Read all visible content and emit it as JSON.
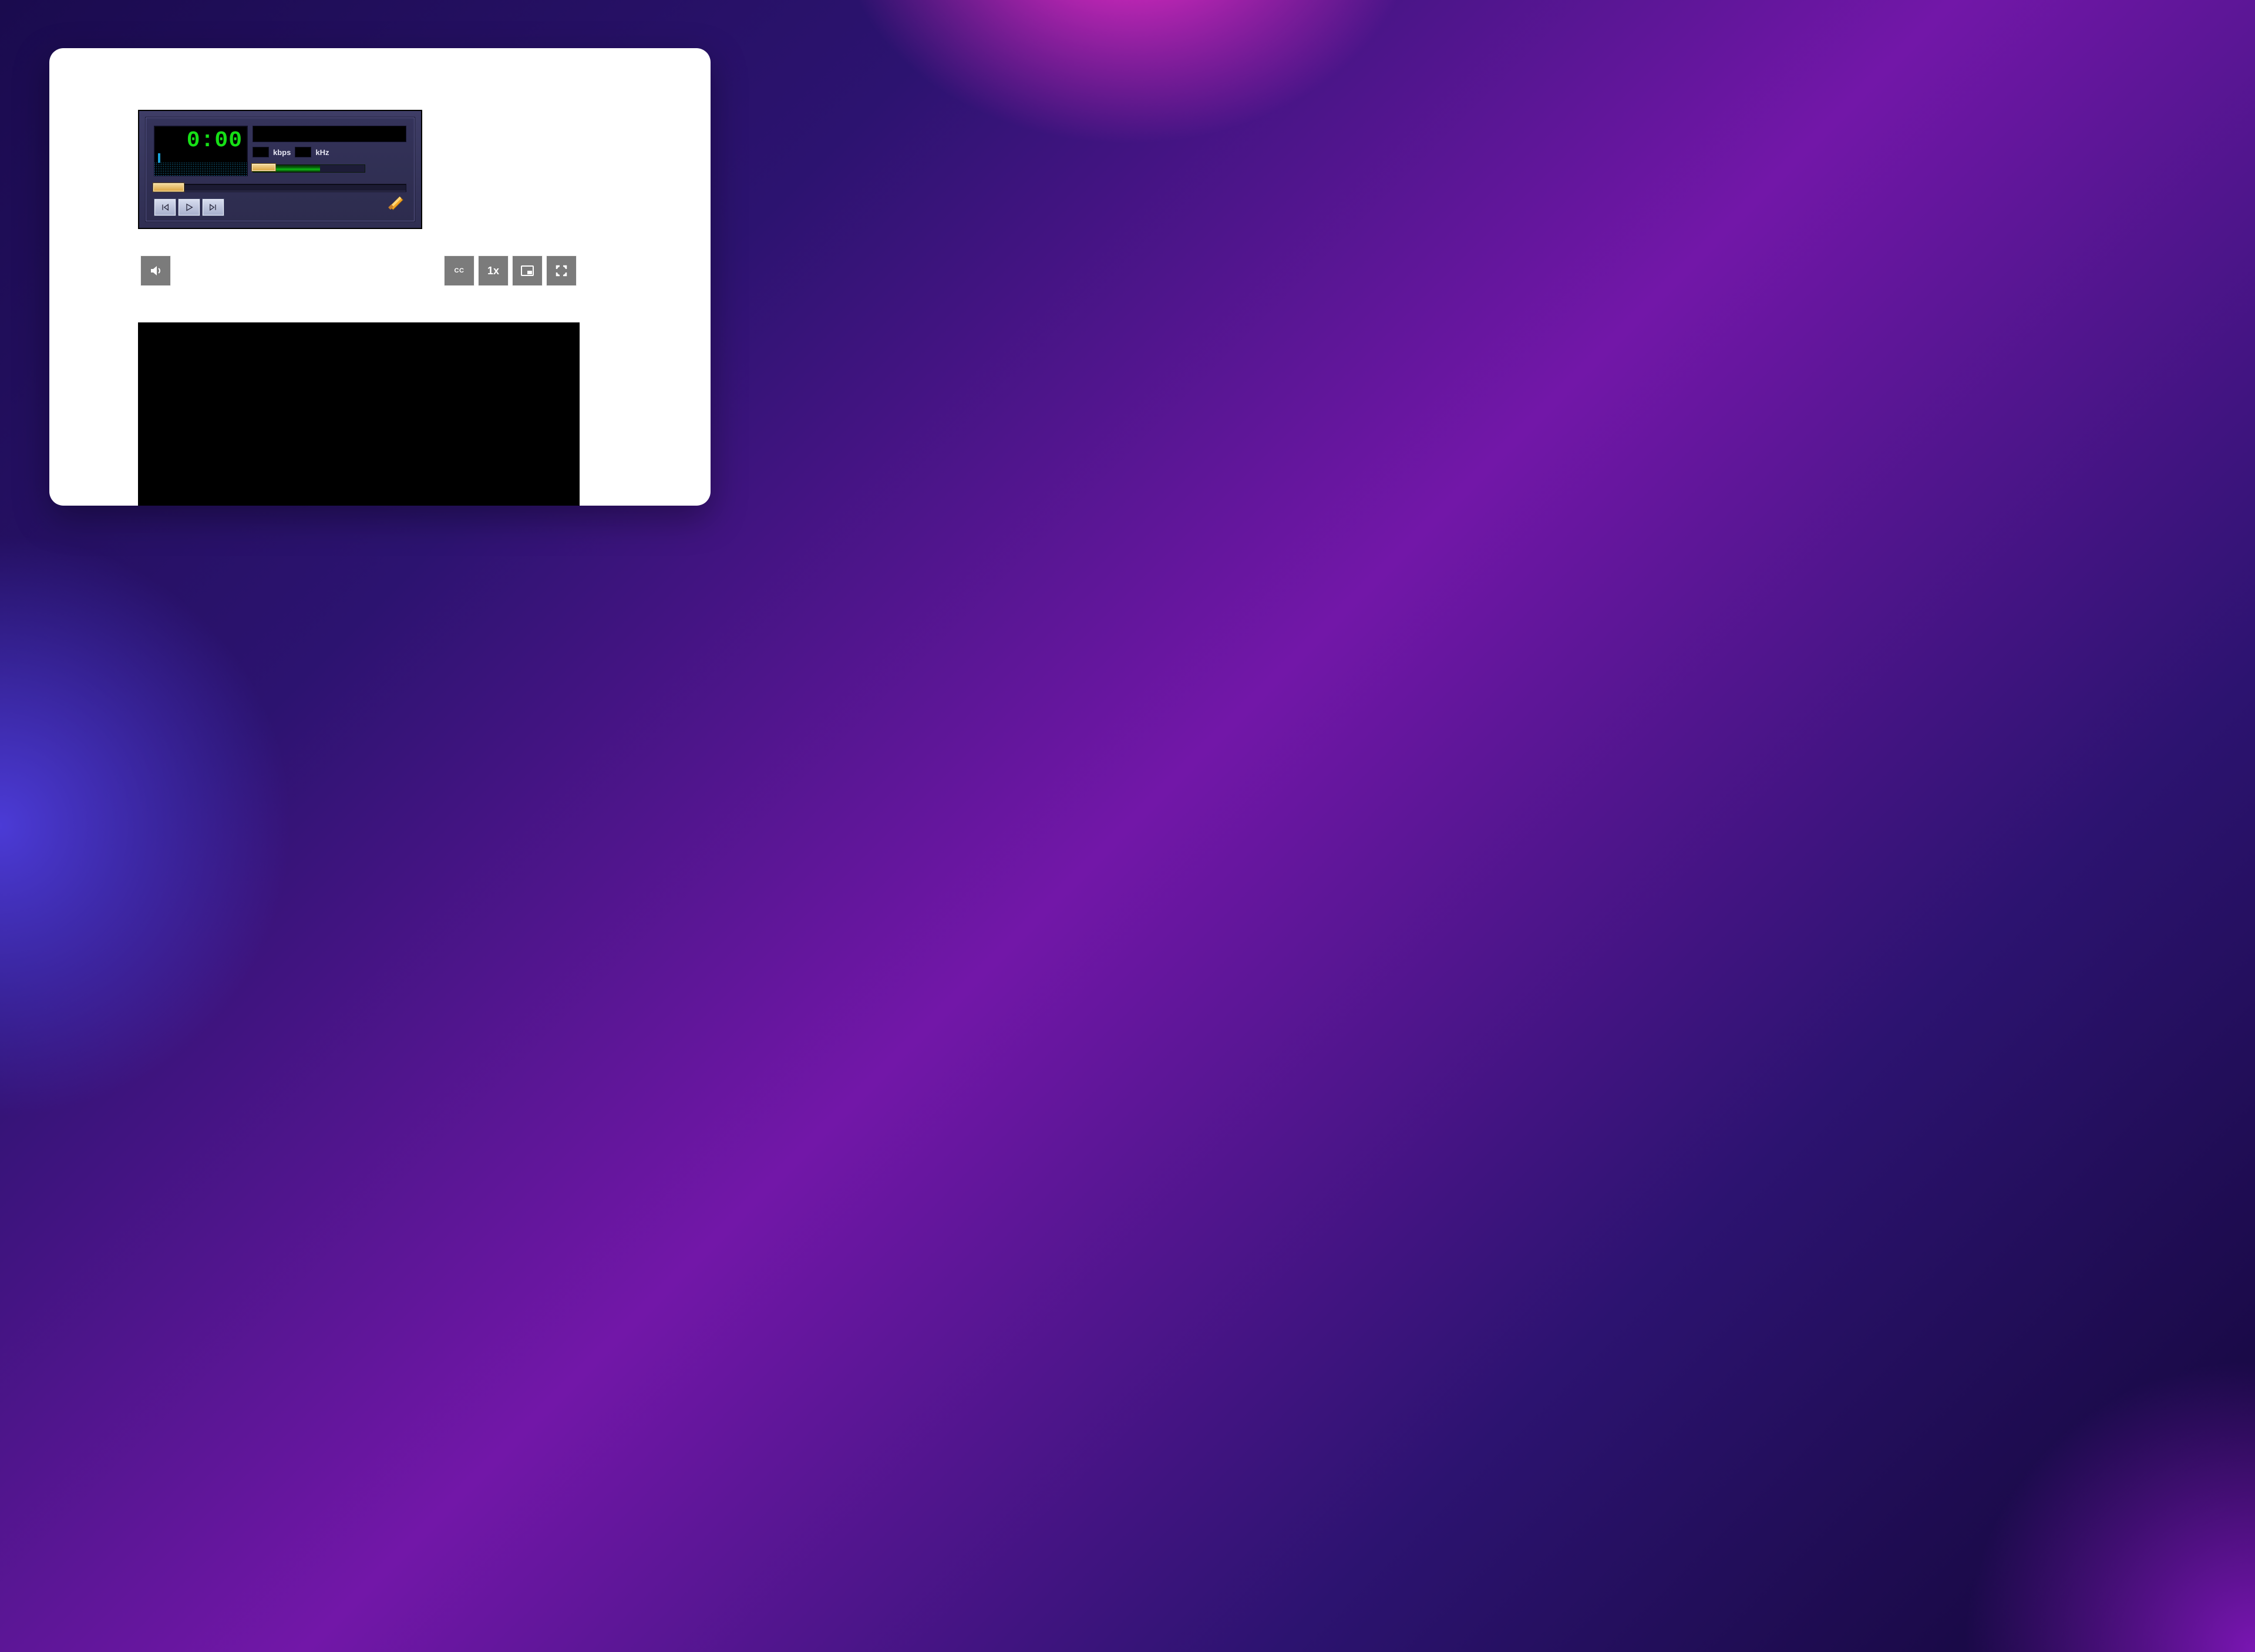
{
  "player": {
    "time": "0:00",
    "kbps_label": "kbps",
    "khz_label": "kHz",
    "kbps_value": "",
    "khz_value": "",
    "track_title": "",
    "buttons": {
      "prev": "previous",
      "play": "play",
      "next": "next"
    },
    "volume_percent": 25,
    "seek_percent": 0
  },
  "toolbar": {
    "volume": "volume",
    "captions": "CC",
    "rate": "1x",
    "pip": "picture-in-picture",
    "fullscreen": "fullscreen"
  }
}
